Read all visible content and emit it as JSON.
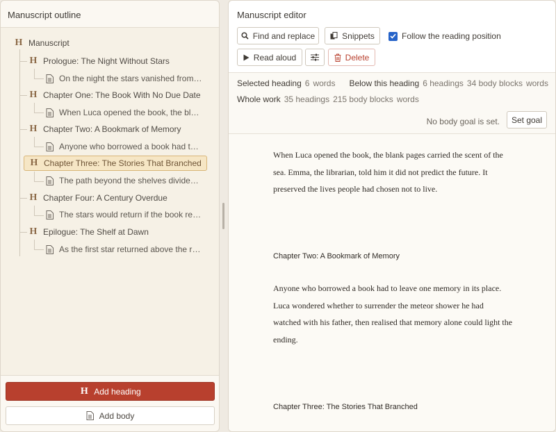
{
  "outline": {
    "title": "Manuscript outline",
    "root_label": "Manuscript",
    "chapters": [
      {
        "heading": "Prologue: The Night Without Stars",
        "body": "On the night the stars vanished from the sky"
      },
      {
        "heading": "Chapter One: The Book With No Due Date",
        "body": "When Luca opened the book, the blank pages carried the scent of the sea."
      },
      {
        "heading": "Chapter Two: A Bookmark of Memory",
        "body": "Anyone who borrowed a book had to leave one memory in its place."
      },
      {
        "heading": "Chapter Three: The Stories That Branched",
        "body": "The path beyond the shelves divided the world"
      },
      {
        "heading": "Chapter Four: A Century Overdue",
        "body": "The stars would return if the book reached its ending"
      },
      {
        "heading": "Epilogue: The Shelf at Dawn",
        "body": "As the first star returned above the rooftops"
      }
    ],
    "selected_index": 3,
    "add_heading_label": "Add heading",
    "add_body_label": "Add body"
  },
  "editor": {
    "title": "Manuscript editor",
    "find_replace_label": "Find and replace",
    "snippets_label": "Snippets",
    "follow_label": "Follow the reading position",
    "follow_checked": true,
    "read_aloud_label": "Read aloud",
    "delete_label": "Delete",
    "stats": {
      "selected_label": "Selected heading",
      "selected_words": "6",
      "words_unit": "words",
      "below_label": "Below this heading",
      "below_headings": "6 headings",
      "below_blocks": "34 body blocks",
      "whole_label": "Whole work",
      "whole_headings": "35 headings",
      "whole_blocks": "215 body blocks"
    },
    "goal_text": "No body goal is set.",
    "set_goal_label": "Set goal",
    "content": {
      "para1": [
        "When Luca opened the book, the blank pages carried the scent of the",
        "sea. Emma, the librarian, told him it did not predict the future. It",
        "preserved the lives people had chosen not to live."
      ],
      "heading2": "Chapter Two: A Bookmark of Memory",
      "para2": [
        "Anyone who borrowed a book had to leave one memory in its place.",
        "Luca wondered whether to surrender the meteor shower he had",
        "watched with his father, then realised that memory alone could light the",
        "ending."
      ],
      "heading3": "Chapter Three: The Stories That Branched"
    }
  },
  "colors": {
    "accent_red": "#b8402e",
    "heading_glyph": "#8c6a48",
    "selected_bg": "#f6e6c5",
    "checkbox_blue": "#2563c9"
  }
}
